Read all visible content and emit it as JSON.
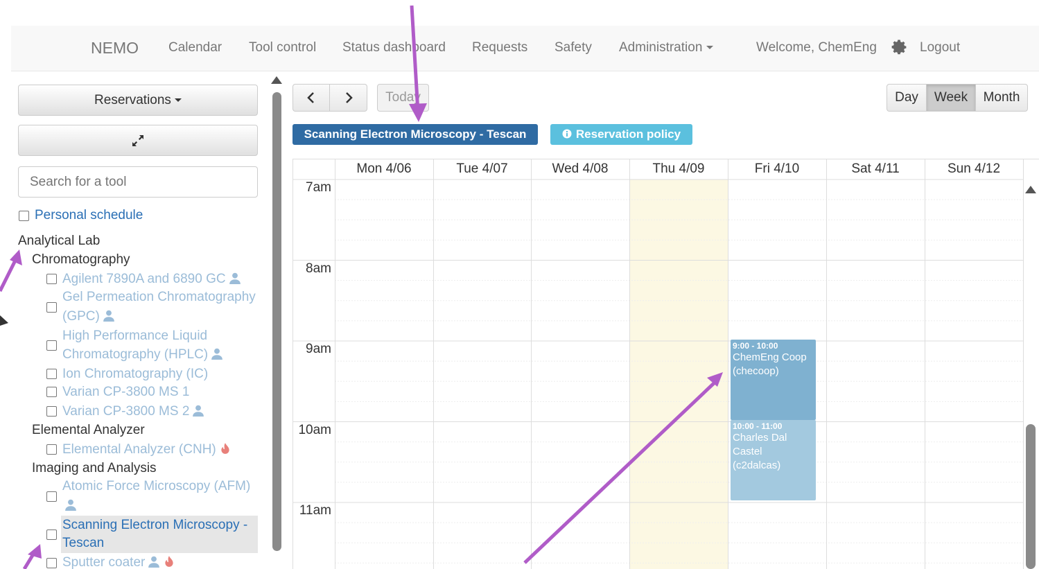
{
  "navbar": {
    "brand": "NEMO",
    "links": [
      "Calendar",
      "Tool control",
      "Status dashboard",
      "Requests",
      "Safety"
    ],
    "admin_label": "Administration",
    "welcome": "Welcome, ChemEng",
    "logout": "Logout"
  },
  "sidebar": {
    "reservations_label": "Reservations",
    "search_placeholder": "Search for a tool",
    "personal_schedule": "Personal schedule",
    "lab": "Analytical Lab",
    "categories": [
      {
        "name": "Chromatography"
      },
      {
        "name": "Elemental Analyzer"
      },
      {
        "name": "Imaging and Analysis"
      }
    ],
    "tools": {
      "agilent": "Agilent 7890A and 6890 GC",
      "gpc_1": "Gel Permeation Chromatography",
      "gpc_2": "(GPC)",
      "hplc_1": "High Performance Liquid",
      "hplc_2": "Chromatography (HPLC)",
      "ic": "Ion Chromatography (IC)",
      "varian1": "Varian CP-3800 MS 1",
      "varian2": "Varian CP-3800 MS 2",
      "elemental": "Elemental Analyzer (CNH)",
      "afm": "Atomic Force Microscopy (AFM)",
      "sem_1": "Scanning Electron Microscopy -",
      "sem_2": "Tescan",
      "sputter": "Sputter coater"
    }
  },
  "toolbar": {
    "prev": "‹",
    "next": "›",
    "today": "Today",
    "views": [
      "Day",
      "Week",
      "Month"
    ],
    "active_view": "Week"
  },
  "calendar": {
    "tool_label": "Scanning Electron Microscopy - Tescan",
    "policy_label": "Reservation policy",
    "days": [
      "Mon 4/06",
      "Tue 4/07",
      "Wed 4/08",
      "Thu 4/09",
      "Fri 4/10",
      "Sat 4/11",
      "Sun 4/12"
    ],
    "today_index": 3,
    "hours": [
      "7am",
      "8am",
      "9am",
      "10am",
      "11am"
    ],
    "events": [
      {
        "time": "9:00 - 10:00",
        "title_1": "ChemEng Coop",
        "title_2": "(checoop)",
        "day": "Fri 4/10",
        "color": "#7fb1d0"
      },
      {
        "time": "10:00 - 11:00",
        "title_1": "Charles Dal",
        "title_2": "Castel",
        "title_3": "(c2dalcas)",
        "day": "Fri 4/10",
        "color": "#a3c9df"
      }
    ]
  },
  "colors": {
    "annotation_arrow": "#b05cc8",
    "today_highlight": "#fcf8e3",
    "primary": "#2f6ba3",
    "info": "#5bc0de"
  }
}
